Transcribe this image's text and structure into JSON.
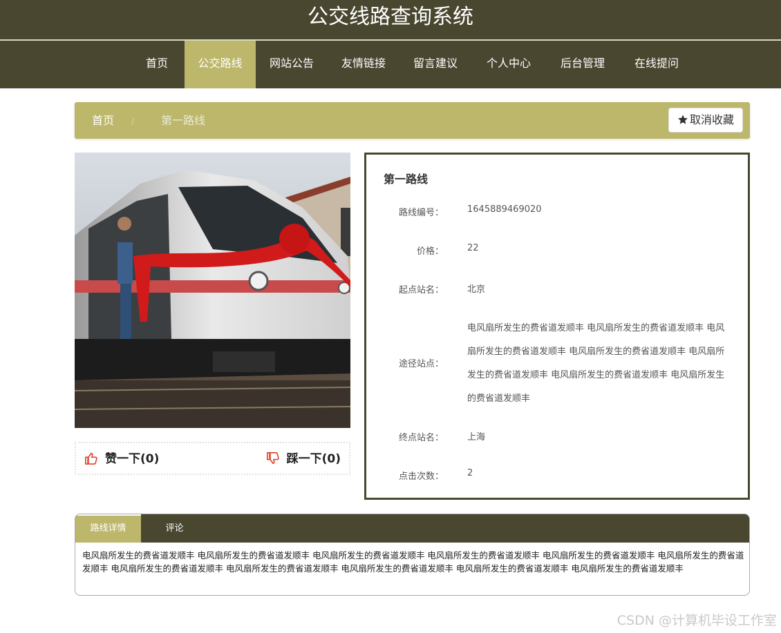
{
  "header": {
    "site_title": "公交线路查询系统"
  },
  "nav": {
    "items": [
      {
        "label": "首页",
        "active": false
      },
      {
        "label": "公交路线",
        "active": true
      },
      {
        "label": "网站公告",
        "active": false
      },
      {
        "label": "友情链接",
        "active": false
      },
      {
        "label": "留言建议",
        "active": false
      },
      {
        "label": "个人中心",
        "active": false
      },
      {
        "label": "后台管理",
        "active": false
      },
      {
        "label": "在线提问",
        "active": false
      }
    ]
  },
  "breadcrumb": {
    "home": "首页",
    "separator": "/",
    "current": "第一路线",
    "favorite_button": "取消收藏"
  },
  "votes": {
    "like_label": "赞一下(0)",
    "dislike_label": "踩一下(0)"
  },
  "route": {
    "title": "第一路线",
    "fields": {
      "number_label": "路线编号：",
      "number_value": "1645889469020",
      "price_label": "价格：",
      "price_value": "22",
      "start_label": "起点站名：",
      "start_value": "北京",
      "stations_label": "途径站点：",
      "stations_value": "电风扇所发生的费省道发顺丰 电风扇所发生的费省道发顺丰 电风扇所发生的费省道发顺丰 电风扇所发生的费省道发顺丰 电风扇所发生的费省道发顺丰 电风扇所发生的费省道发顺丰 电风扇所发生的费省道发顺丰",
      "end_label": "终点站名：",
      "end_value": "上海",
      "clicks_label": "点击次数：",
      "clicks_value": "2"
    }
  },
  "tabs": {
    "items": [
      {
        "label": "路线详情",
        "active": true
      },
      {
        "label": "评论",
        "active": false
      }
    ],
    "detail_text": "电风扇所发生的费省道发顺丰 电风扇所发生的费省道发顺丰 电风扇所发生的费省道发顺丰 电风扇所发生的费省道发顺丰 电风扇所发生的费省道发顺丰 电风扇所发生的费省道发顺丰 电风扇所发生的费省道发顺丰 电风扇所发生的费省道发顺丰 电风扇所发生的费省道发顺丰 电风扇所发生的费省道发顺丰 电风扇所发生的费省道发顺丰"
  },
  "watermark": "CSDN @计算机毕设工作室",
  "colors": {
    "header_bg": "#4a4730",
    "accent": "#bcb76a",
    "like_icon": "#e0412d"
  }
}
